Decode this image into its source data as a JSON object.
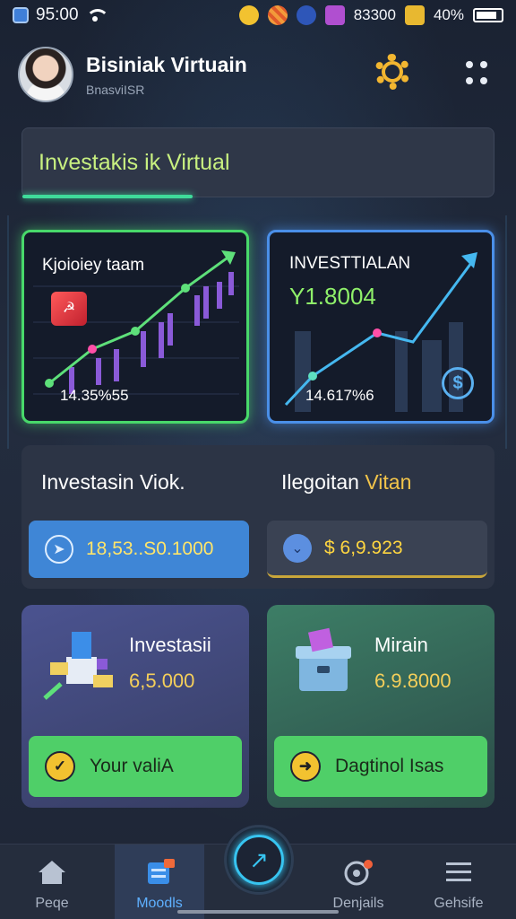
{
  "status_bar": {
    "time": "95:00",
    "extra": "83300",
    "battery": "40%"
  },
  "header": {
    "title": "Bisiniak Virtuain",
    "subtitle": "BnasviISR"
  },
  "banner": {
    "text": "Investakis ik Virtual"
  },
  "chart_cards": [
    {
      "title": "Kjoioiey taam",
      "footer": "14.35%55",
      "accent": "#48d86a"
    },
    {
      "title": "INVESTTIALAN",
      "value": "Y1.8004",
      "footer": "14.617%6",
      "accent": "#4a8fe8"
    }
  ],
  "mid_panel": {
    "left_label": "Investasin Viok.",
    "right_label_a": "Ilegoitan ",
    "right_label_b": "Vitan",
    "left_value": "18,53..S0.1000",
    "right_value": "$ 6,9.923"
  },
  "feature_cards": [
    {
      "title": "Investasii",
      "amount": "6,5.000",
      "button": "Your valiA",
      "button_icon": "check-icon"
    },
    {
      "title": "Mirain",
      "amount": "6.9.8000",
      "button": "Dagtinol Isas",
      "button_icon": "arrow-icon"
    }
  ],
  "bottom_nav": {
    "items": [
      "Peqe",
      "Moodls",
      "Denjails",
      "Gehsife"
    ],
    "active": "Moodls"
  },
  "colors": {
    "green_accent": "#48d86a",
    "blue_accent": "#4a8fe8",
    "gold": "#f2b630"
  }
}
